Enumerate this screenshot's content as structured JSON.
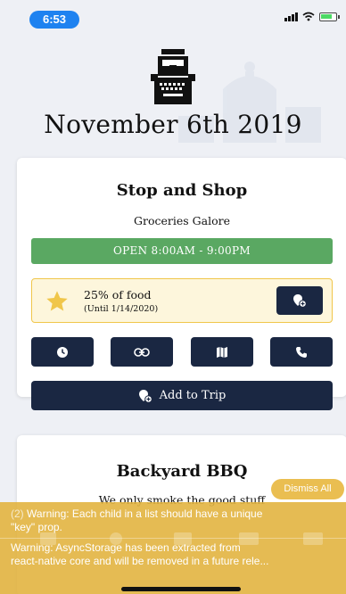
{
  "status_bar": {
    "time": "6:53"
  },
  "header": {
    "date_title": "November 6th 2019",
    "icon": "typewriter-icon"
  },
  "cards": [
    {
      "name": "Stop and Shop",
      "description": "Groceries Galore",
      "hours": "OPEN 8:00AM - 9:00PM",
      "deal": {
        "title": "25% of food",
        "until": "(Until 1/14/2020)",
        "icon": "star-icon",
        "button_icon": "add-location-icon"
      },
      "actions": [
        {
          "icon": "clock-icon"
        },
        {
          "icon": "link-icon"
        },
        {
          "icon": "map-icon"
        },
        {
          "icon": "phone-icon"
        }
      ],
      "add_trip_label": "Add to Trip"
    },
    {
      "name": "Backyard BBQ",
      "description": "We only smoke the good stuff"
    }
  ],
  "warnings": {
    "dismiss_label": "Dismiss All",
    "items": [
      {
        "count": "(2)",
        "text": "Warning: Each child in a list should have a unique",
        "text2": "\"key\" prop."
      },
      {
        "text": "Warning: AsyncStorage has been extracted from",
        "text2": "react-native core and will be removed in a future rele..."
      }
    ]
  },
  "colors": {
    "primary": "#1a2742",
    "open_green": "#5aa862",
    "deal_bg": "#fdf6dc",
    "deal_border": "#f0c64a",
    "warning": "#e2b440",
    "time_pill": "#1e82f0"
  }
}
